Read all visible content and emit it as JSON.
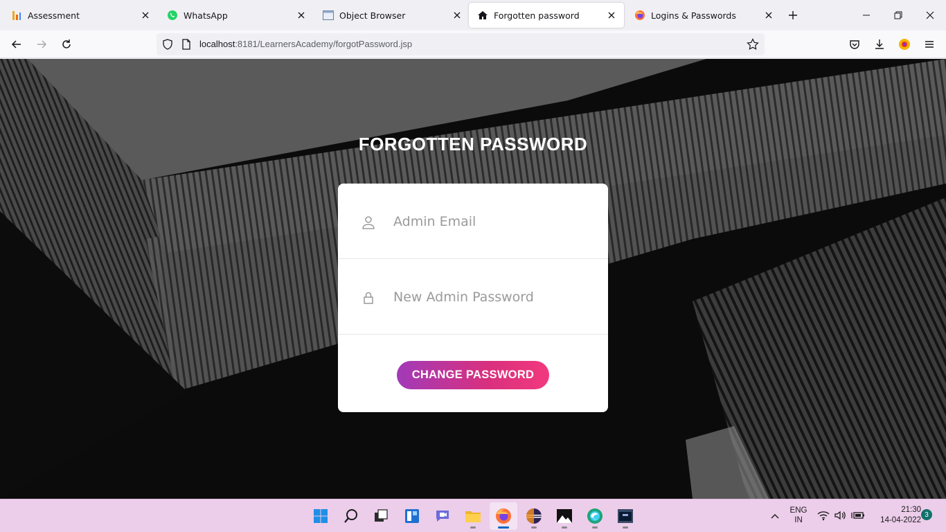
{
  "browser": {
    "tabs": [
      {
        "label": "Assessment",
        "icon": "bar-chart-icon",
        "active": false
      },
      {
        "label": "WhatsApp",
        "icon": "whatsapp-icon",
        "active": false
      },
      {
        "label": "Object Browser",
        "icon": "window-icon",
        "active": false
      },
      {
        "label": "Forgotten password",
        "icon": "home-icon",
        "active": true
      },
      {
        "label": "Logins & Passwords",
        "icon": "firefox-icon",
        "active": false
      }
    ],
    "url_host": "localhost",
    "url_rest": ":8181/LearnersAcademy/forgotPassword.jsp"
  },
  "page": {
    "title": "FORGOTTEN PASSWORD",
    "email_placeholder": "Admin Email",
    "password_placeholder": "New Admin Password",
    "submit_label": "CHANGE PASSWORD",
    "accent_gradient": [
      "#a13ab8",
      "#f2397e"
    ]
  },
  "taskbar": {
    "apps": [
      "start",
      "search",
      "task-view",
      "widgets",
      "teams-chat",
      "file-explorer",
      "firefox",
      "eclipse",
      "photos",
      "edge-dev",
      "terminal"
    ],
    "active_app": "firefox",
    "language_line1": "ENG",
    "language_line2": "IN",
    "time": "21:30",
    "date": "14-04-2022",
    "notification_count": "3"
  }
}
